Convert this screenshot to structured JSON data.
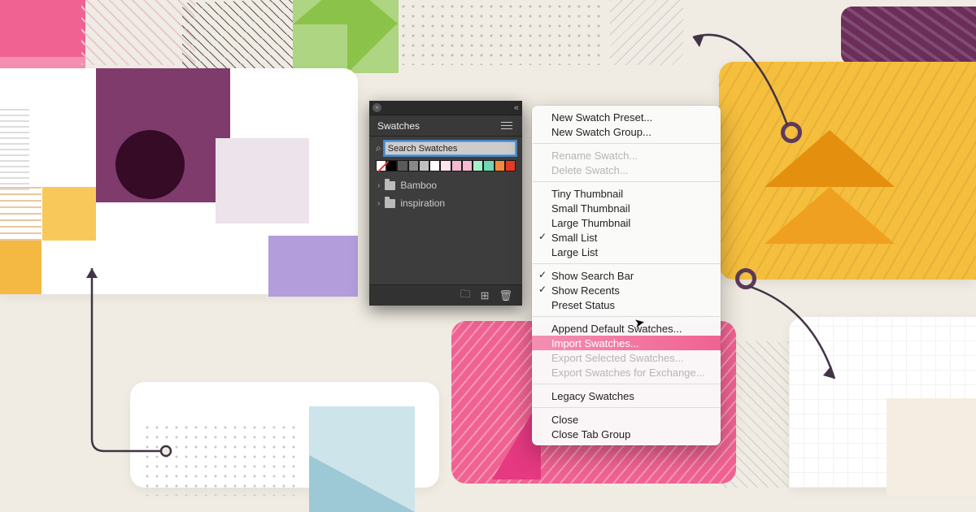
{
  "panel": {
    "tab_label": "Swatches",
    "search_placeholder": "Search Swatches",
    "folders": [
      {
        "name": "Bamboo"
      },
      {
        "name": "inspiration"
      }
    ],
    "swatch_colors": [
      "#000000",
      "#5a5a5a",
      "#888888",
      "#bfbfbf",
      "#ffffff",
      "#fde4ef",
      "#f4b9d0",
      "#f4b9d0",
      "#a5efc6",
      "#6fd8b2",
      "#f48a3c",
      "#e83a25"
    ],
    "footer_icons": [
      "folder-icon",
      "new-swatch-icon",
      "trash-icon"
    ]
  },
  "menu": {
    "items": [
      {
        "label": "New Swatch Preset...",
        "state": "normal"
      },
      {
        "label": "New Swatch Group...",
        "state": "normal"
      },
      {
        "sep": true
      },
      {
        "label": "Rename Swatch...",
        "state": "disabled"
      },
      {
        "label": "Delete Swatch...",
        "state": "disabled"
      },
      {
        "sep": true
      },
      {
        "label": "Tiny Thumbnail",
        "state": "normal"
      },
      {
        "label": "Small Thumbnail",
        "state": "normal"
      },
      {
        "label": "Large Thumbnail",
        "state": "normal"
      },
      {
        "label": "Small List",
        "state": "checked"
      },
      {
        "label": "Large List",
        "state": "normal"
      },
      {
        "sep": true
      },
      {
        "label": "Show Search Bar",
        "state": "checked"
      },
      {
        "label": "Show Recents",
        "state": "checked"
      },
      {
        "label": "Preset Status",
        "state": "normal"
      },
      {
        "sep": true
      },
      {
        "label": "Append Default Swatches...",
        "state": "normal"
      },
      {
        "label": "Import Swatches...",
        "state": "highlight"
      },
      {
        "label": "Export Selected Swatches...",
        "state": "disabled"
      },
      {
        "label": "Export Swatches for Exchange...",
        "state": "disabled"
      },
      {
        "sep": true
      },
      {
        "label": "Legacy Swatches",
        "state": "normal"
      },
      {
        "sep": true
      },
      {
        "label": "Close",
        "state": "normal"
      },
      {
        "label": "Close Tab Group",
        "state": "normal"
      }
    ]
  }
}
